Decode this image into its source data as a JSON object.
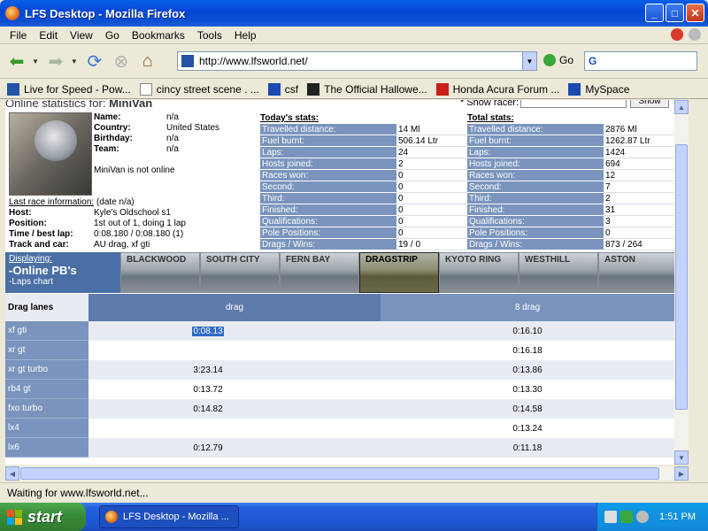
{
  "window": {
    "title": "LFS Desktop - Mozilla Firefox"
  },
  "menu": [
    "File",
    "Edit",
    "View",
    "Go",
    "Bookmarks",
    "Tools",
    "Help"
  ],
  "nav": {
    "url": "http://www.lfsworld.net/",
    "go_label": "Go",
    "search_value": "G"
  },
  "bookmarks": [
    {
      "label": "Live for Speed - Pow...",
      "icon": "lfs-icon"
    },
    {
      "label": "cincy street scene . ...",
      "icon": "google-icon"
    },
    {
      "label": "csf",
      "icon": "people-icon"
    },
    {
      "label": "The Official Hallowe...",
      "icon": "halloween-icon"
    },
    {
      "label": "Honda Acura Forum ...",
      "icon": "honda-icon"
    },
    {
      "label": "MySpace",
      "icon": "people-icon"
    }
  ],
  "page": {
    "header_label": "Online statistics for:",
    "racer_name": "MiniVan",
    "show_racer_label": "* Show racer:",
    "show_button": "Show",
    "profile": [
      {
        "k": "Name:",
        "v": "n/a"
      },
      {
        "k": "Country:",
        "v": "United States"
      },
      {
        "k": "Birthday:",
        "v": "n/a"
      },
      {
        "k": "Team:",
        "v": "n/a"
      }
    ],
    "online_status": "MiniVan is not online",
    "last_race_label": "Last race information:",
    "last_race_date": "(date n/a)",
    "race_info": [
      {
        "k": "Host:",
        "v": "Kyle's Oldschool s1"
      },
      {
        "k": "Position:",
        "v": "1st out of 1, doing 1 lap"
      },
      {
        "k": "Time / best lap:",
        "v": "0:08.180 / 0:08.180 (1)"
      },
      {
        "k": "Track and car:",
        "v": "AU drag, xf gti"
      }
    ],
    "today_title": "Today's stats:",
    "today": [
      {
        "k": "Travelled distance:",
        "v": "14 Ml"
      },
      {
        "k": "Fuel burnt:",
        "v": "506.14 Ltr"
      },
      {
        "k": "Laps:",
        "v": "24"
      },
      {
        "k": "Hosts joined:",
        "v": "2"
      },
      {
        "k": "Races won:",
        "v": "0"
      },
      {
        "k": "Second:",
        "v": "0"
      },
      {
        "k": "Third:",
        "v": "0"
      },
      {
        "k": "Finished:",
        "v": "0"
      },
      {
        "k": "Qualifications:",
        "v": "0"
      },
      {
        "k": "Pole Positions:",
        "v": "0"
      },
      {
        "k": "Drags / Wins:",
        "v": "19 / 0"
      }
    ],
    "total_title": "Total stats:",
    "total": [
      {
        "k": "Travelled distance:",
        "v": "2876 Ml"
      },
      {
        "k": "Fuel burnt:",
        "v": "1262.87 Ltr"
      },
      {
        "k": "Laps:",
        "v": "1424"
      },
      {
        "k": "Hosts joined:",
        "v": "694"
      },
      {
        "k": "Races won:",
        "v": "12"
      },
      {
        "k": "Second:",
        "v": "7"
      },
      {
        "k": "Third:",
        "v": "2"
      },
      {
        "k": "Finished:",
        "v": "31"
      },
      {
        "k": "Qualifications:",
        "v": "3"
      },
      {
        "k": "Pole Positions:",
        "v": "0"
      },
      {
        "k": "Drags / Wins:",
        "v": "873 / 264"
      }
    ],
    "displaying_label": "Displaying:",
    "displaying_main": "-Online PB's",
    "displaying_sub": "-Laps chart",
    "tracks": [
      "BLACKWOOD",
      "SOUTH CITY",
      "FERN BAY",
      "DRAGSTRIP",
      "KYOTO RING",
      "WESTHILL",
      "ASTON"
    ],
    "active_track": "DRAGSTRIP",
    "table_headers": [
      "Drag lanes",
      "drag",
      "8 drag"
    ],
    "rows": [
      {
        "car": "xf gti",
        "drag": "0:08.13",
        "drag8": "0:16.10"
      },
      {
        "car": "xr gt",
        "drag": "",
        "drag8": "0:16.18"
      },
      {
        "car": "xr gt turbo",
        "drag": "3:23.14",
        "drag8": "0:13.86"
      },
      {
        "car": "rb4 gt",
        "drag": "0:13.72",
        "drag8": "0:13.30"
      },
      {
        "car": "fxo turbo",
        "drag": "0:14.82",
        "drag8": "0:14.58"
      },
      {
        "car": "lx4",
        "drag": "",
        "drag8": "0:13.24"
      },
      {
        "car": "lx6",
        "drag": "0:12.79",
        "drag8": "0:11.18"
      }
    ]
  },
  "status": "Waiting for www.lfsworld.net...",
  "taskbar": {
    "start": "start",
    "item": "LFS Desktop - Mozilla ...",
    "clock": "1:51 PM"
  }
}
